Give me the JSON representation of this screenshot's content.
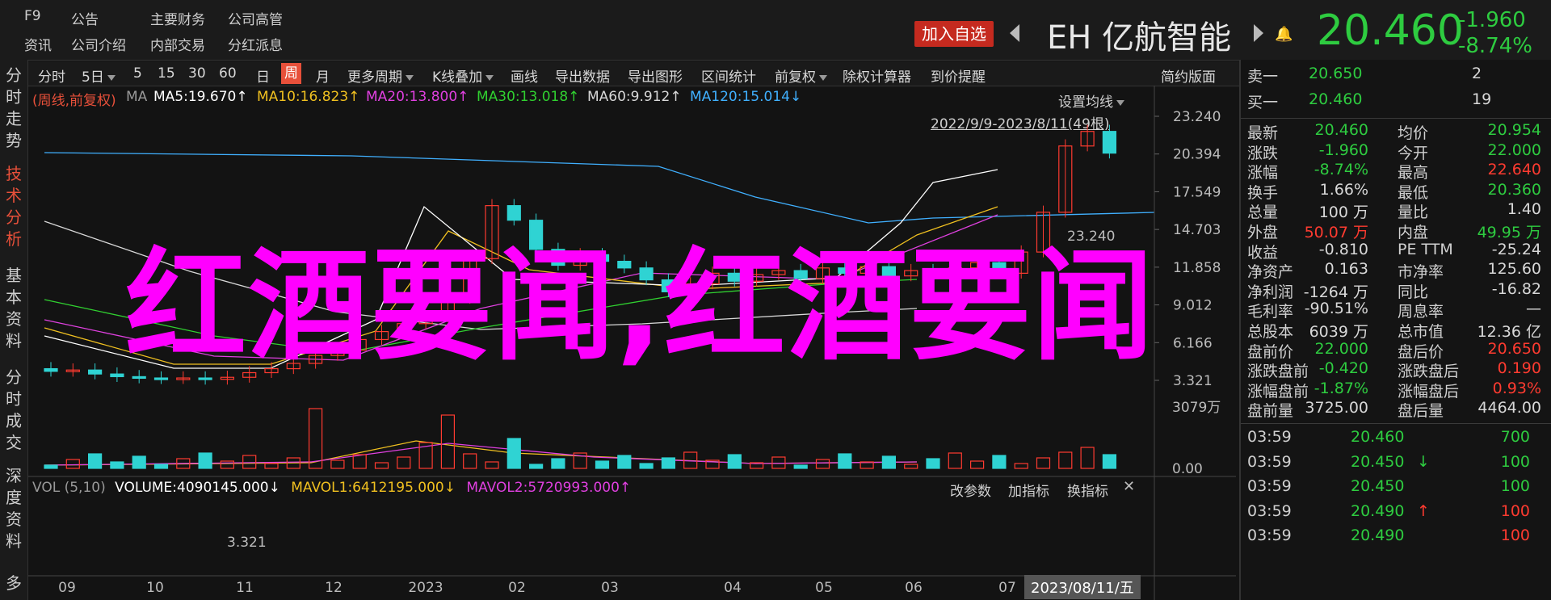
{
  "topnav": {
    "row1": [
      "F9",
      "公告",
      "主要财务",
      "公司高管"
    ],
    "row2": [
      "资讯",
      "公司介绍",
      "内部交易",
      "分红派息"
    ]
  },
  "header": {
    "add_fav": "加入自选",
    "code": "EH",
    "name": "亿航智能",
    "price": "20.460",
    "change": "-1.960",
    "change_pct": "-8.74%"
  },
  "left_tabs": [
    {
      "label": "分时走势",
      "active": false
    },
    {
      "label": "技术分析",
      "active": true
    },
    {
      "label": "基本资料",
      "active": false
    },
    {
      "label": "分时成交",
      "active": false
    },
    {
      "label": "深度资料",
      "active": false
    },
    {
      "label": "多",
      "active": false
    }
  ],
  "toolbar": {
    "items": [
      "分时",
      "5日",
      "5",
      "15",
      "30",
      "60",
      "日",
      "周",
      "月",
      "更多周期",
      "K线叠加",
      "画线",
      "导出数据",
      "导出图形",
      "区间统计",
      "前复权",
      "除权计算器",
      "到价提醒",
      "简约版面"
    ],
    "active": "周"
  },
  "ma_legend": {
    "period": "(周线,前复权)",
    "ma": "MA",
    "items": [
      {
        "text": "MA5:19.670↑",
        "color": "#ffffff"
      },
      {
        "text": "MA10:16.823↑",
        "color": "#f0c020"
      },
      {
        "text": "MA20:13.800↑",
        "color": "#e040e0"
      },
      {
        "text": "MA30:13.018↑",
        "color": "#30d030"
      },
      {
        "text": "MA60:9.912↑",
        "color": "#d8d8d8"
      },
      {
        "text": "MA120:15.014↓",
        "color": "#40b0ff"
      }
    ],
    "settings": "设置均线",
    "range": "2022/9/9-2023/8/11(49根)"
  },
  "chart_data": {
    "type": "candlestick",
    "price_axis": [
      "23.240",
      "20.394",
      "17.549",
      "14.703",
      "11.858",
      "9.012",
      "6.166",
      "3.321"
    ],
    "high_label": "23.240",
    "low_label": "3.321",
    "volume_legend": {
      "title": "VOL (5,10)",
      "volume": "VOLUME:4090145.000↓",
      "mavol1": "MAVOL1:6412195.000↓",
      "mavol2": "MAVOL2:5720993.000↑",
      "buttons": [
        "改参数",
        "加指标",
        "换指标"
      ]
    },
    "volume_axis": [
      "3079万",
      "0.00"
    ],
    "x_labels": [
      "09",
      "10",
      "11",
      "12",
      "2023",
      "02",
      "03",
      "04",
      "05",
      "06",
      "07"
    ],
    "date_badge": "2023/08/11/五"
  },
  "order_book": [
    {
      "label": "卖一",
      "price": "20.650",
      "vol": "2"
    },
    {
      "label": "买一",
      "price": "20.460",
      "vol": "19"
    }
  ],
  "quote": [
    {
      "l1": "最新",
      "v1": "20.460",
      "c1": "g",
      "l2": "均价",
      "v2": "20.954",
      "c2": "g"
    },
    {
      "l1": "涨跌",
      "v1": "-1.960",
      "c1": "g",
      "l2": "今开",
      "v2": "22.000",
      "c2": "g"
    },
    {
      "l1": "涨幅",
      "v1": "-8.74%",
      "c1": "g",
      "l2": "最高",
      "v2": "22.640",
      "c2": "r"
    },
    {
      "l1": "换手",
      "v1": "1.66%",
      "c1": "w",
      "l2": "最低",
      "v2": "20.360",
      "c2": "g"
    },
    {
      "l1": "总量",
      "v1": "100 万",
      "c1": "w",
      "l2": "量比",
      "v2": "1.40",
      "c2": "w"
    },
    {
      "l1": "外盘",
      "v1": "50.07 万",
      "c1": "r",
      "l2": "内盘",
      "v2": "49.95 万",
      "c2": "g"
    },
    {
      "l1": "收益",
      "v1": "-0.810",
      "c1": "w",
      "l2": "PE TTM",
      "v2": "-25.24",
      "c2": "w"
    },
    {
      "l1": "净资产",
      "v1": "0.163",
      "c1": "w",
      "l2": "市净率",
      "v2": "125.60",
      "c2": "w"
    },
    {
      "l1": "净利润",
      "v1": "-1264 万",
      "c1": "w",
      "l2": "同比",
      "v2": "-16.82",
      "c2": "w"
    },
    {
      "l1": "毛利率",
      "v1": "-90.51%",
      "c1": "w",
      "l2": "周息率",
      "v2": "—",
      "c2": "w"
    },
    {
      "l1": "总股本",
      "v1": "6039 万",
      "c1": "w",
      "l2": "总市值",
      "v2": "12.36 亿",
      "c2": "w"
    },
    {
      "l1": "盘前价",
      "v1": "22.000",
      "c1": "g",
      "l2": "盘后价",
      "v2": "20.650",
      "c2": "r"
    },
    {
      "l1": "涨跌盘前",
      "v1": "-0.420",
      "c1": "g",
      "l2": "涨跌盘后",
      "v2": "0.190",
      "c2": "r"
    },
    {
      "l1": "涨幅盘前",
      "v1": "-1.87%",
      "c1": "g",
      "l2": "涨幅盘后",
      "v2": "0.93%",
      "c2": "r"
    },
    {
      "l1": "盘前量",
      "v1": "3725.00",
      "c1": "w",
      "l2": "盘后量",
      "v2": "4464.00",
      "c2": "w"
    }
  ],
  "ticks": [
    {
      "time": "03:59",
      "price": "20.460",
      "pc": "g",
      "dir": "",
      "vol": "700",
      "vc": "g"
    },
    {
      "time": "03:59",
      "price": "20.450",
      "pc": "g",
      "dir": "↓",
      "vol": "100",
      "vc": "g"
    },
    {
      "time": "03:59",
      "price": "20.450",
      "pc": "g",
      "dir": "",
      "vol": "100",
      "vc": "g"
    },
    {
      "time": "03:59",
      "price": "20.490",
      "pc": "g",
      "dir": "↑",
      "vol": "100",
      "vc": "r"
    },
    {
      "time": "03:59",
      "price": "20.490",
      "pc": "g",
      "dir": "",
      "vol": "100",
      "vc": "r"
    }
  ],
  "overlay_text": "红酒要闻,红酒要闻"
}
